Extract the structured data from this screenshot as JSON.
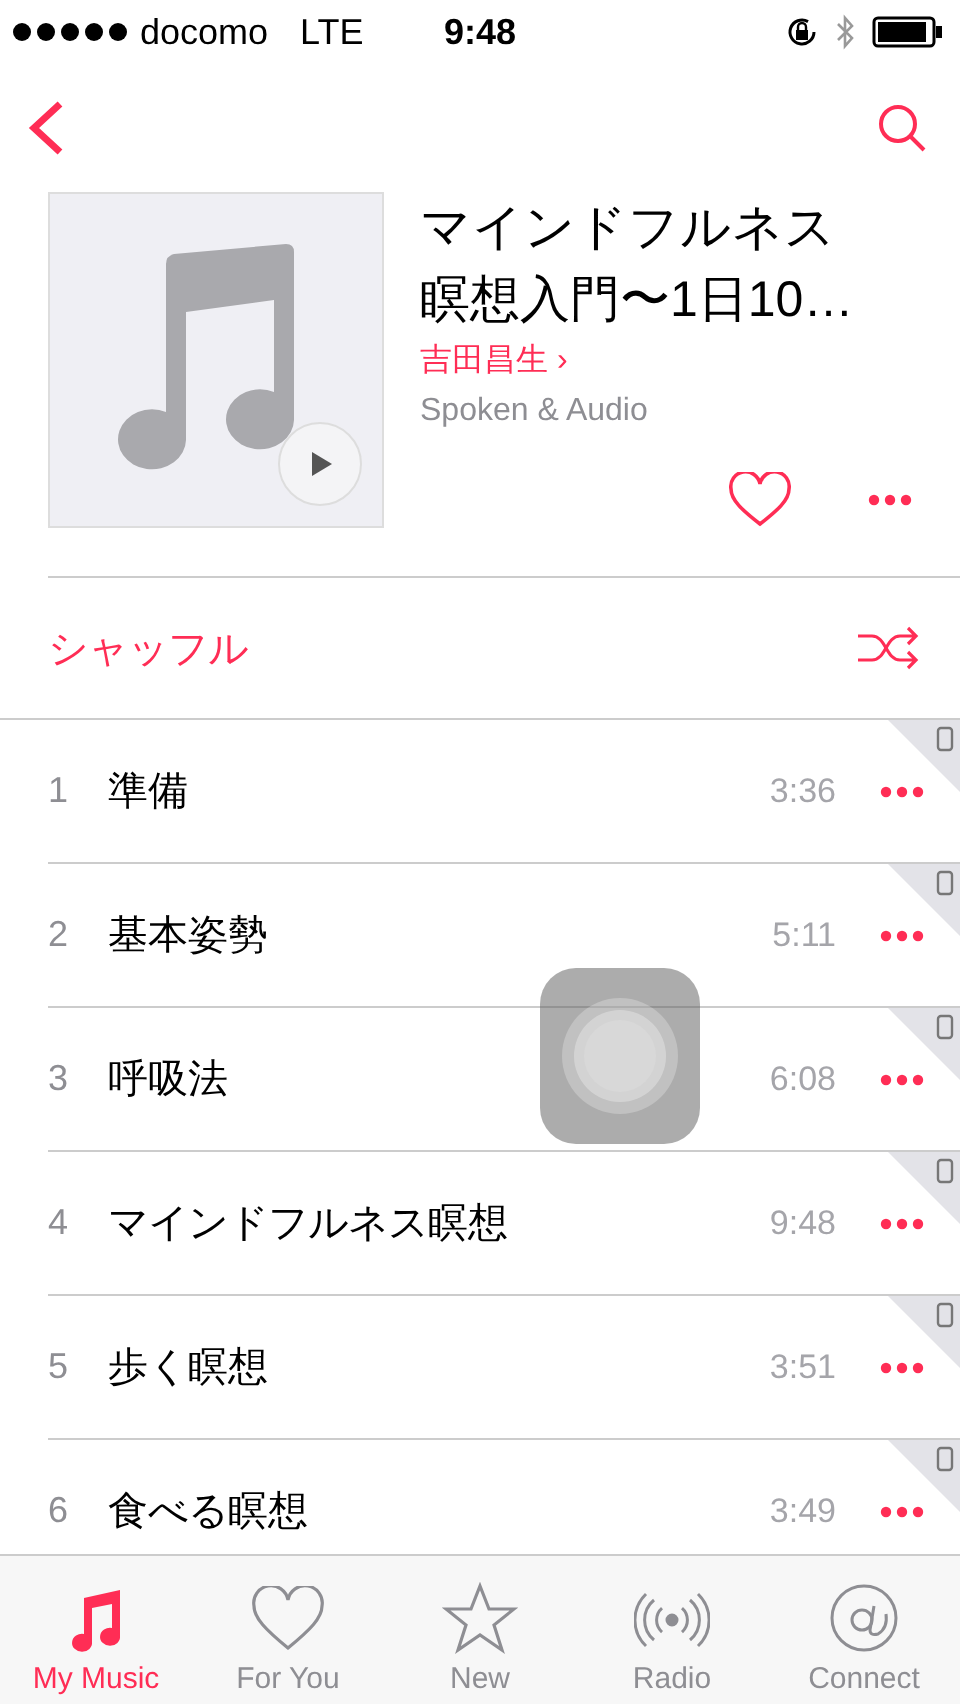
{
  "status_bar": {
    "carrier": "docomo",
    "network": "LTE",
    "time": "9:48"
  },
  "album": {
    "title": [
      "マインドフルネス",
      "瞑想入門〜1日10…"
    ],
    "artist": "吉田昌生",
    "artist_chevron": "›",
    "genre": "Spoken & Audio"
  },
  "shuffle": {
    "label": "シャッフル"
  },
  "tracks": [
    {
      "number": "1",
      "title": "準備",
      "duration": "3:36"
    },
    {
      "number": "2",
      "title": "基本姿勢",
      "duration": "5:11"
    },
    {
      "number": "3",
      "title": "呼吸法",
      "duration": "6:08"
    },
    {
      "number": "4",
      "title": "マインドフルネス瞑想",
      "duration": "9:48"
    },
    {
      "number": "5",
      "title": "歩く瞑想",
      "duration": "3:51"
    },
    {
      "number": "6",
      "title": "食べる瞑想",
      "duration": "3:49"
    }
  ],
  "tab_bar": [
    {
      "kind": "music",
      "label": "My Music",
      "selected": true
    },
    {
      "kind": "heart",
      "label": "For You",
      "selected": false
    },
    {
      "kind": "star",
      "label": "New",
      "selected": false
    },
    {
      "kind": "radio",
      "label": "Radio",
      "selected": false
    },
    {
      "kind": "at",
      "label": "Connect",
      "selected": false
    }
  ]
}
